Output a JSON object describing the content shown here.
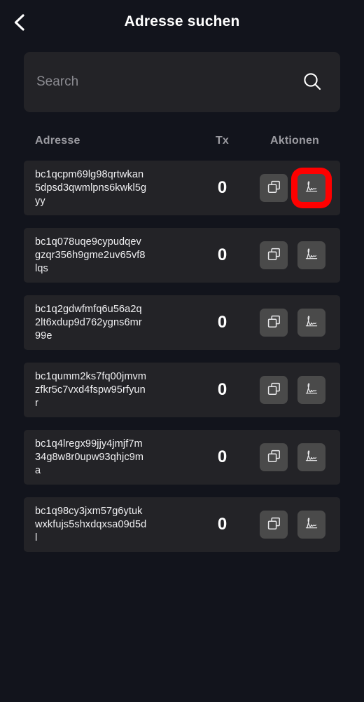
{
  "header": {
    "back_icon": "chevron-left-icon",
    "title": "Adresse suchen"
  },
  "search": {
    "value": "",
    "placeholder": "Search",
    "icon": "search-icon"
  },
  "table": {
    "columns": [
      "Adresse",
      "Tx",
      "Aktionen"
    ],
    "actions": {
      "copy_icon": "copy-icon",
      "sign_icon": "signature-icon"
    },
    "rows": [
      {
        "address": "bc1qcpm69lg98qrtwkan5dpsd3qwmlpns6kwkl5gyy",
        "tx": "0"
      },
      {
        "address": "bc1q078uqe9cypudqevgzqr356h9gme2uv65vf8lqs",
        "tx": "0"
      },
      {
        "address": "bc1q2gdwfmfq6u56a2q2lt6xdup9d762ygns6mr99e",
        "tx": "0"
      },
      {
        "address": "bc1qumm2ks7fq00jmvmzfkr5c7vxd4fspw95rfyunr",
        "tx": "0"
      },
      {
        "address": "bc1q4lregx99jjy4jmjf7m34g8w8r0upw93qhjc9ma",
        "tx": "0"
      },
      {
        "address": "bc1q98cy3jxm57g6ytukwxkfujs5shxdqxsa09d5dl",
        "tx": "0"
      }
    ]
  },
  "annotation": {
    "highlight_color": "#ff0000",
    "highlighted_row_index": 0,
    "highlighted_control": "signature-button"
  },
  "colors": {
    "page_background": "#12141c",
    "surface": "#232327",
    "button": "#4a4a4a",
    "header_text": "#9b9ba1",
    "text": "#ffffff"
  }
}
